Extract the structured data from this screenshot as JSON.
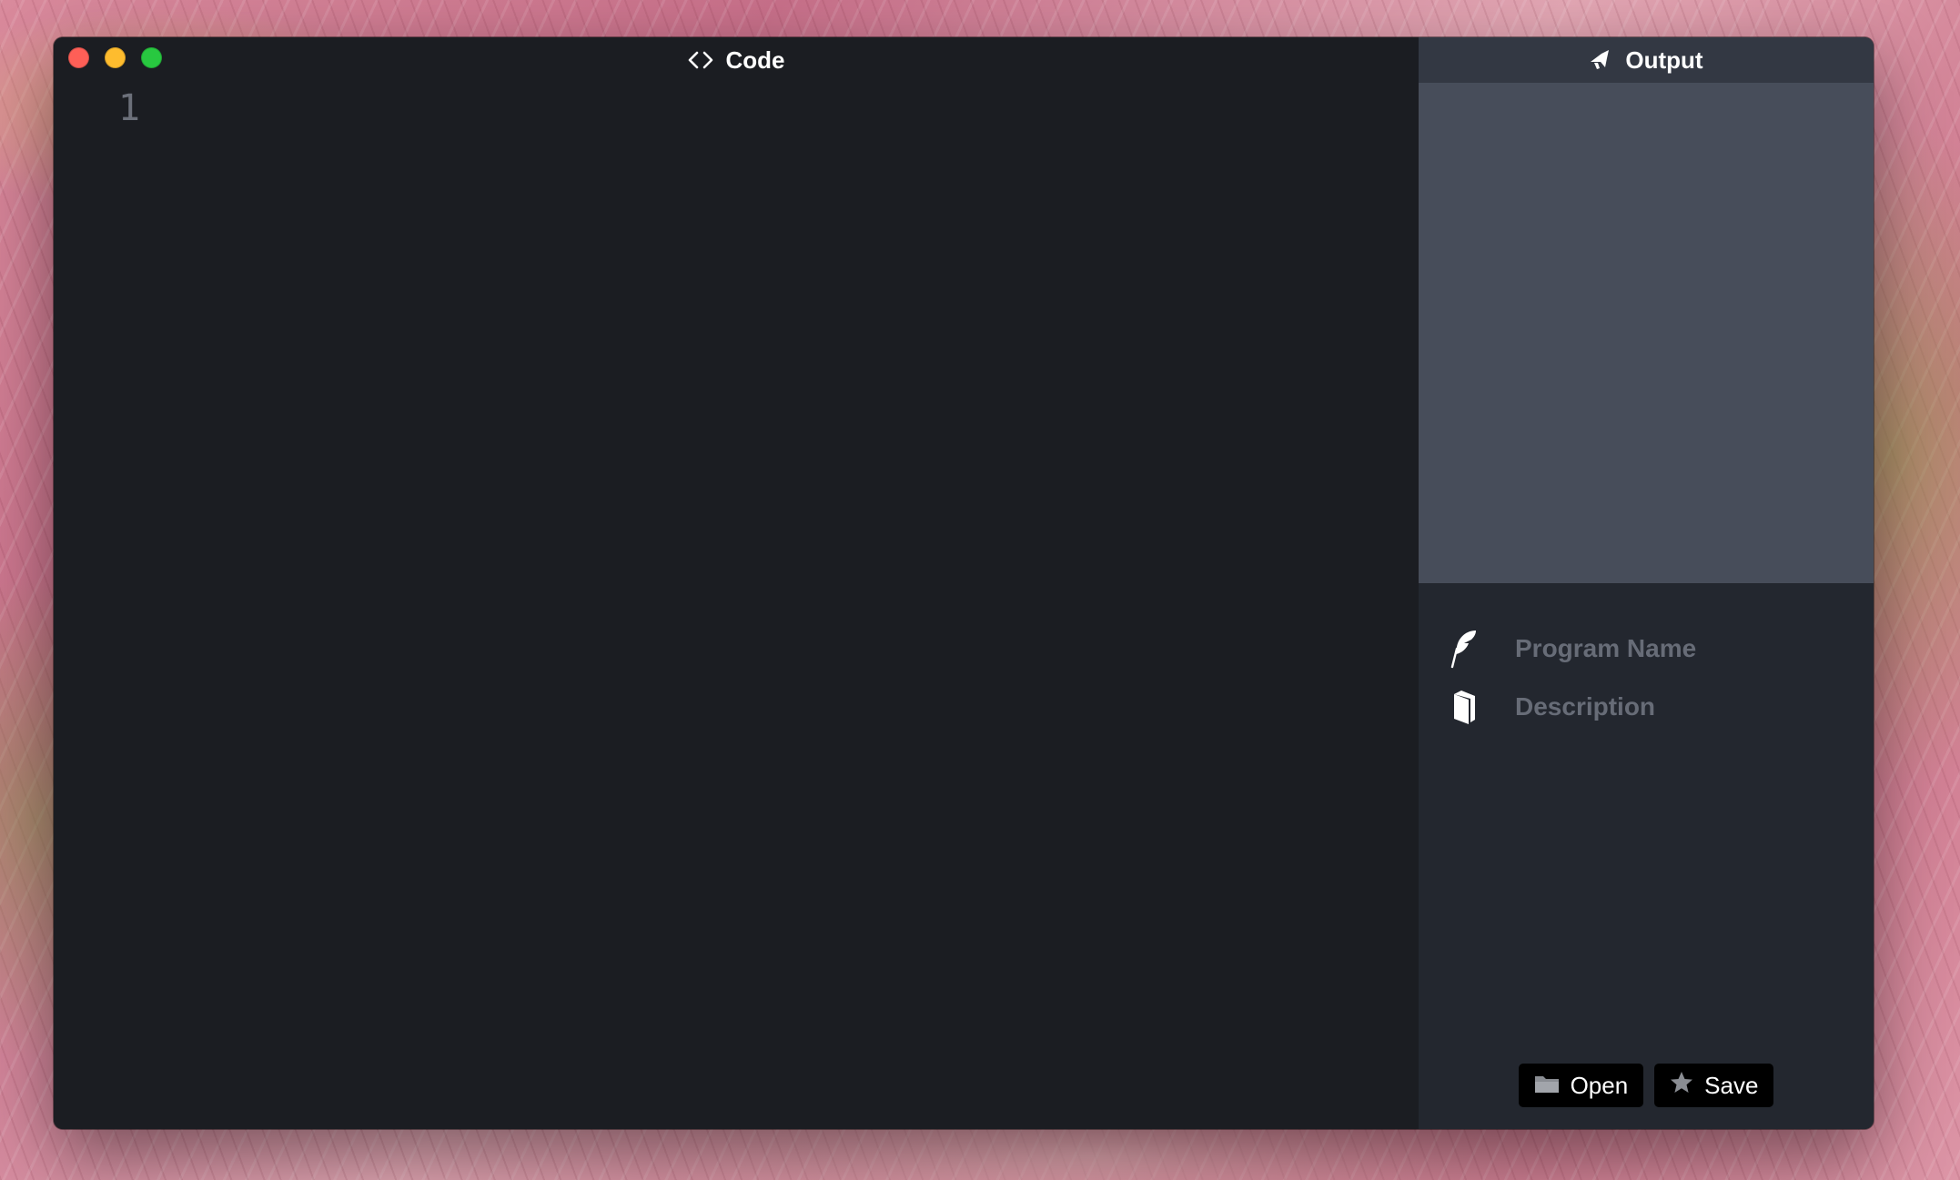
{
  "code_pane": {
    "title": "Code",
    "title_icon": "code-brackets-icon",
    "lines": [
      {
        "number": "1",
        "text": ""
      }
    ]
  },
  "output_pane": {
    "title": "Output",
    "title_icon": "megaphone-icon",
    "output_text": "",
    "program_name": {
      "icon": "feather-icon",
      "value": "",
      "placeholder": "Program Name"
    },
    "description": {
      "icon": "book-icon",
      "value": "",
      "placeholder": "Description"
    },
    "buttons": {
      "open_label": "Open",
      "open_icon": "folder-icon",
      "save_label": "Save",
      "save_icon": "star-icon"
    }
  },
  "colors": {
    "editor_bg": "#1b1d22",
    "output_header_bg": "#333843",
    "output_area_bg": "#474d5a",
    "sidebar_bg": "#23272f",
    "traffic_close": "#fe5f57",
    "traffic_minimize": "#febc2e",
    "traffic_maximize": "#28c840"
  }
}
